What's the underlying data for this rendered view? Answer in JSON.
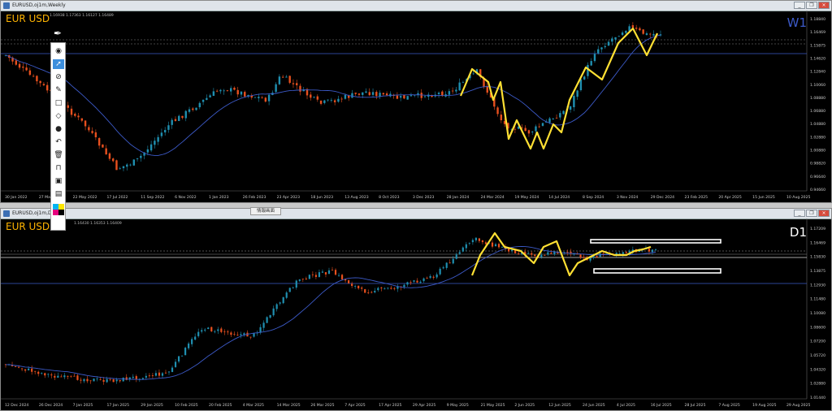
{
  "top_window": {
    "title": "EURUSD,oj1m,Weekly",
    "pair_label": "EUR USD",
    "timeframe_label": "W1",
    "ohlc": "1.16938 1.17363 1.16127 1.16489",
    "price_labels": [
      "1.18840",
      "1.16469",
      "1.15875",
      "1.14620",
      "1.12840",
      "1.10060",
      "1.08880",
      "1.06880",
      "1.04880",
      "1.02880",
      "1.00880",
      "0.98820",
      "0.96640",
      "0.94660"
    ],
    "date_labels": [
      "30 Jan 2022",
      "27 Mar 2022",
      "22 May 2022",
      "17 Jul 2022",
      "11 Sep 2022",
      "6 Nov 2022",
      "1 Jan 2023",
      "26 Feb 2023",
      "23 Apr 2023",
      "18 Jun 2023",
      "13 Aug 2023",
      "8 Oct 2023",
      "3 Dec 2023",
      "28 Jan 2024",
      "24 Mar 2024",
      "19 May 2024",
      "14 Jul 2024",
      "8 Sep 2024",
      "3 Nov 2024",
      "29 Dec 2024",
      "23 Feb 2025",
      "20 Apr 2025",
      "15 Jun 2025",
      "10 Aug 2025"
    ]
  },
  "bottom_window": {
    "title": "EURUSD,oj1m,Daily",
    "pair_label": "EUR USD",
    "timeframe_label": "D1",
    "ohlc": "1.16430 1.16353 1.16409",
    "price_labels": [
      "1.17209",
      "1.16469",
      "1.15830",
      "1.13875",
      "1.12930",
      "1.11480",
      "1.10080",
      "1.08600",
      "1.07200",
      "1.05720",
      "1.04320",
      "1.02880",
      "1.01440"
    ],
    "date_labels": [
      "12 Dec 2024",
      "26 Dec 2024",
      "7 Jan 2025",
      "17 Jan 2025",
      "29 Jan 2025",
      "10 Feb 2025",
      "20 Feb 2025",
      "4 Mar 2025",
      "14 Mar 2025",
      "26 Mar 2025",
      "7 Apr 2025",
      "17 Apr 2025",
      "29 Apr 2025",
      "9 May 2025",
      "21 May 2025",
      "2 Jun 2025",
      "12 Jun 2025",
      "24 Jun 2025",
      "4 Jul 2025",
      "16 Jul 2025",
      "28 Jul 2025",
      "7 Aug 2025",
      "19 Aug 2025",
      "29 Aug 2025"
    ]
  },
  "tab_button_label": "情報画面",
  "window_buttons": {
    "minimize": "_",
    "restore": "❐",
    "close": "×"
  },
  "toolbar_icons": [
    "eye-icon",
    "cursor-icon",
    "crosshair-icon",
    "pencil-icon",
    "rectangle-icon",
    "eraser-icon",
    "dot-icon",
    "undo-icon",
    "trash-icon",
    "magnet-icon",
    "screenshot-icon",
    "clipboard-icon",
    "color-palette-icon"
  ],
  "colors": {
    "bull": "#1f8fb0",
    "bear": "#e8501e",
    "zigzag": "#ffe033",
    "ma": "#3c5ac8",
    "hline": "#3c5ac8",
    "pair": "#ffb400",
    "tf_top": "#3c5ac8",
    "tf_bottom": "#ffffff"
  }
}
